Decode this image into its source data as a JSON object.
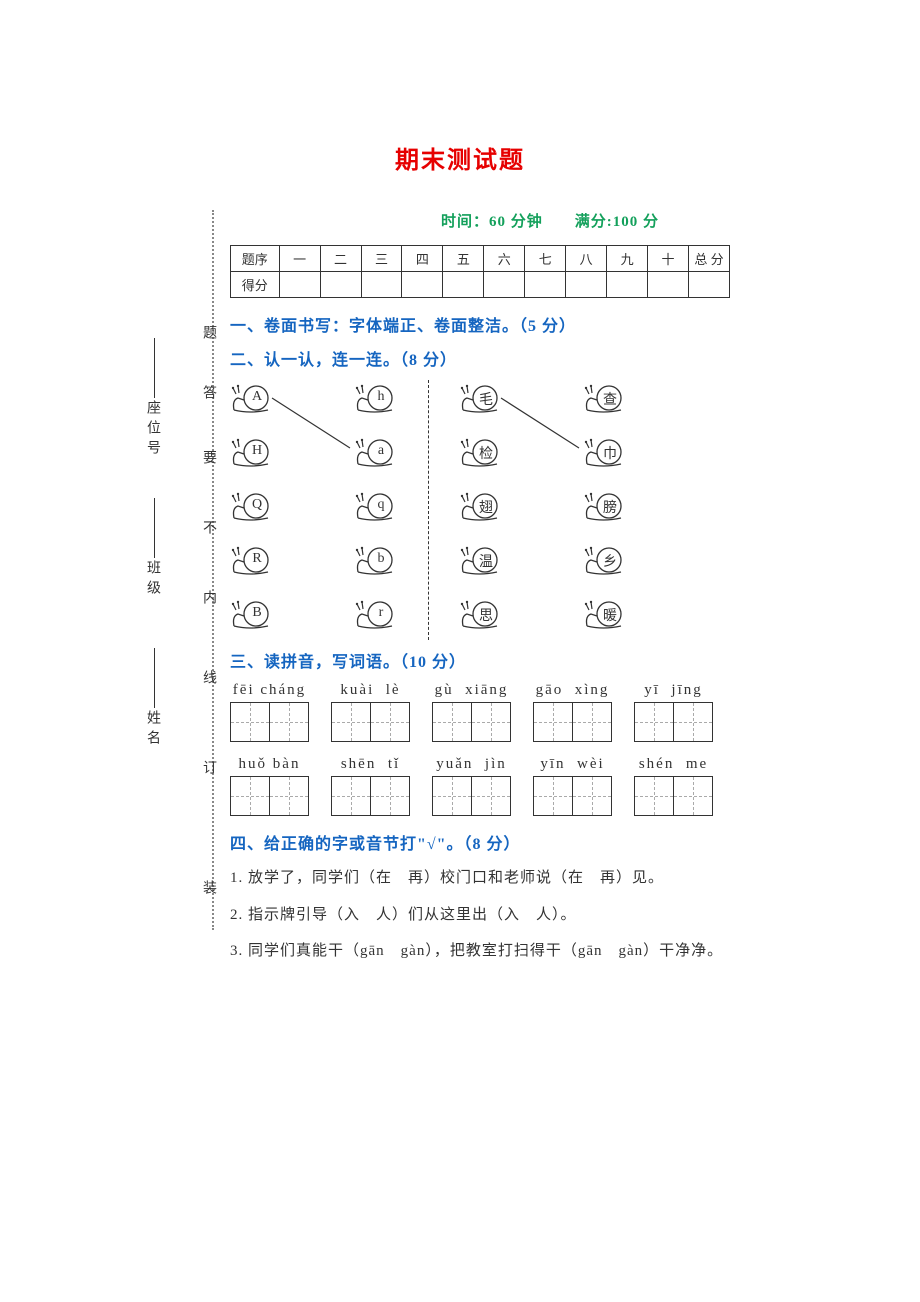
{
  "title": "期末测试题",
  "exam_info": "时间：60 分钟　　满分:100 分",
  "score_table": {
    "row1_label": "题序",
    "headers": [
      "一",
      "二",
      "三",
      "四",
      "五",
      "六",
      "七",
      "八",
      "九",
      "十",
      "总 分"
    ],
    "row2_label": "得分"
  },
  "margin": {
    "zhuang": "装",
    "ding": "订",
    "xian": "线",
    "nei": "内",
    "bu": "不",
    "yao": "要",
    "da": "答",
    "ti": "题",
    "seat": "座位号",
    "class": "班级",
    "name": "姓名"
  },
  "sections": {
    "s1": "一、卷面书写：字体端正、卷面整洁。（5 分）",
    "s2": "二、认一认，连一连。（8 分）",
    "s3": "三、读拼音，写词语。（10 分）",
    "s4": "四、给正确的字或音节打\"√\"。（8 分）"
  },
  "match": {
    "left_a": [
      "A",
      "H",
      "Q",
      "R",
      "B"
    ],
    "left_b": [
      "h",
      "a",
      "q",
      "b",
      "r"
    ],
    "right_a": [
      "毛",
      "检",
      "翅",
      "温",
      "思"
    ],
    "right_b": [
      "查",
      "巾",
      "膀",
      "乡",
      "暖"
    ]
  },
  "pinyin": {
    "row1": [
      {
        "py": "fēi cháng"
      },
      {
        "py": "kuài  lè"
      },
      {
        "py": "gù  xiāng"
      },
      {
        "py": "gāo  xìng"
      },
      {
        "py": "yī  jīng"
      }
    ],
    "row2": [
      {
        "py": "huǒ bàn"
      },
      {
        "py": "shēn  tǐ"
      },
      {
        "py": "yuǎn  jìn"
      },
      {
        "py": "yīn  wèi"
      },
      {
        "py": "shén  me"
      }
    ]
  },
  "q4": {
    "l1": "1. 放学了，同学们（在　再）校门口和老师说（在　再）见。",
    "l2": "2. 指示牌引导（入　人）们从这里出（入　人）。",
    "l3": "3. 同学们真能干（gān　gàn），把教室打扫得干（gān　gàn）干净净。"
  }
}
